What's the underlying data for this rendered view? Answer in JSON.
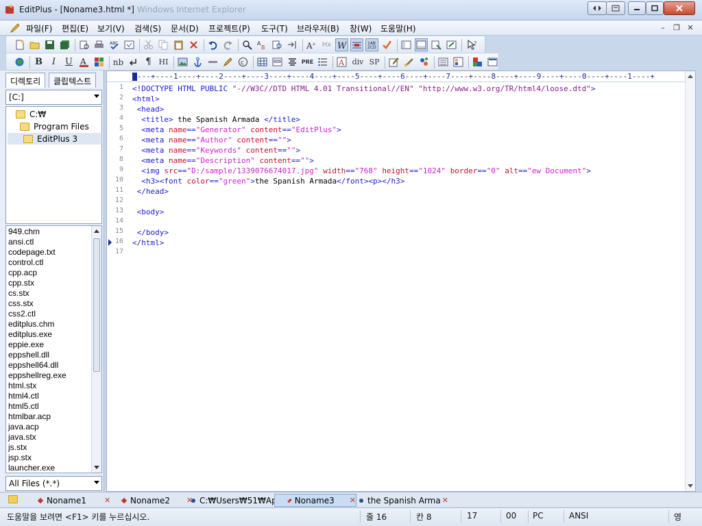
{
  "window": {
    "title": "EditPlus - [Noname3.html *]",
    "ghost_title": "Windows Internet Explorer"
  },
  "menu": [
    "파일(F)",
    "편집(E)",
    "보기(V)",
    "검색(S)",
    "문서(D)",
    "프로젝트(P)",
    "도구(T)",
    "브라우저(B)",
    "창(W)",
    "도움말(H)"
  ],
  "toolbar2": {
    "bold": "B",
    "italic": "I",
    "underline": "U",
    "nb": "nb",
    "hi": "HI",
    "pre": "PRE",
    "div": "div",
    "sp": "SP"
  },
  "left_panel": {
    "tabs": [
      "디렉토리",
      "클립텍스트"
    ],
    "drive": "[C:]",
    "tree": [
      "C:₩",
      "Program Files",
      "EditPlus 3"
    ],
    "files": [
      "949.chm",
      "ansi.ctl",
      "codepage.txt",
      "control.ctl",
      "cpp.acp",
      "cpp.stx",
      "cs.stx",
      "css.stx",
      "css2.ctl",
      "editplus.chm",
      "editplus.exe",
      "eppie.exe",
      "eppshell.dll",
      "eppshell64.dll",
      "eppshellreg.exe",
      "html.stx",
      "html4.ctl",
      "html5.ctl",
      "htmlbar.acp",
      "java.acp",
      "java.stx",
      "js.stx",
      "jsp.stx",
      "launcher.exe"
    ],
    "filter": "All Files (*.*)"
  },
  "editor": {
    "ruler": "---+----1----+----2----+----3----+----4----+----5----+----6----+----7----+----8----+----9----+----0----+----1----+",
    "line_numbers": [
      "1",
      "2",
      "3",
      "4",
      "5",
      "6",
      "7",
      "8",
      "9",
      "10",
      "11",
      "12",
      "13",
      "14",
      "15",
      "16",
      "17"
    ],
    "lines": [
      "<!DOCTYPE HTML PUBLIC \"-//W3C//DTD HTML 4.01 Transitional//EN\" \"http://www.w3.org/TR/html4/loose.dtd\">",
      "<html>",
      " <head>",
      "  <title> the Spanish Armada </title>",
      "  <meta name=\"Generator\" content=\"EditPlus\">",
      "  <meta name=\"Author\" content=\"\">",
      "  <meta name=\"Keywords\" content=\"\">",
      "  <meta name=\"Description\" content=\"\">",
      "  <img src=\"D:/sample/1339076674017.jpg\" width=\"768\" height=\"1024\" border=\"0\" alt=\"ew Document\">",
      "  <h3><font color=\"green\">the Spanish Armada</font><p></h3>",
      " </head>",
      "",
      " <body>",
      "",
      " </body>",
      "</html>",
      ""
    ]
  },
  "doc_tabs": [
    "Noname1",
    "Noname2",
    "C:₩Users₩51₩Ap",
    "Noname3",
    "the Spanish Arma"
  ],
  "status": {
    "help": "도움말을 보려면 <F1> 키를 누르십시오.",
    "line": "줄 16",
    "col": "칸 8",
    "count": "17",
    "code": "00",
    "pc": "PC",
    "encoding": "ANSI",
    "ime": "영"
  }
}
